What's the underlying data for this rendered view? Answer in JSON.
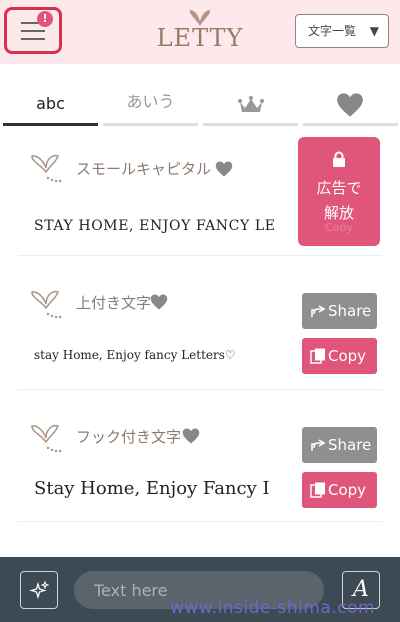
{
  "header": {
    "menu_badge": "!",
    "logo": "LETTY",
    "char_list_label": "文字一覧",
    "char_list_caret": "▼"
  },
  "tabs": [
    {
      "label": "abc",
      "active": true
    },
    {
      "label": "あいう",
      "active": false
    },
    {
      "icon": "crown-icon",
      "active": false
    },
    {
      "icon": "heart-icon",
      "active": false
    }
  ],
  "styles": [
    {
      "name": "スモールキャピタル",
      "sample": "STAY HOME, ENJOY FANCY LE",
      "locked": true,
      "unlock_line1": "広告で",
      "unlock_line2": "解放",
      "ghost_label": "Copy"
    },
    {
      "name": "上付き文字",
      "sample": "stay Home, Enjoy fancy Letters♡",
      "share_label": "Share",
      "copy_label": "Copy"
    },
    {
      "name": "フック付き文字",
      "sample": "Stay Home, Enjoy Fancy I",
      "share_label": "Share",
      "copy_label": "Copy"
    }
  ],
  "bottom_bar": {
    "input_placeholder": "Text here",
    "font_button_label": "A"
  },
  "watermark": "www.inside-shima.com",
  "colors": {
    "header_bg": "#fde8ec",
    "accent_pink": "#e0557a",
    "share_gray": "#8f8f8f",
    "bottom_bar": "#3d4a54",
    "menu_highlight": "#d9304f"
  }
}
